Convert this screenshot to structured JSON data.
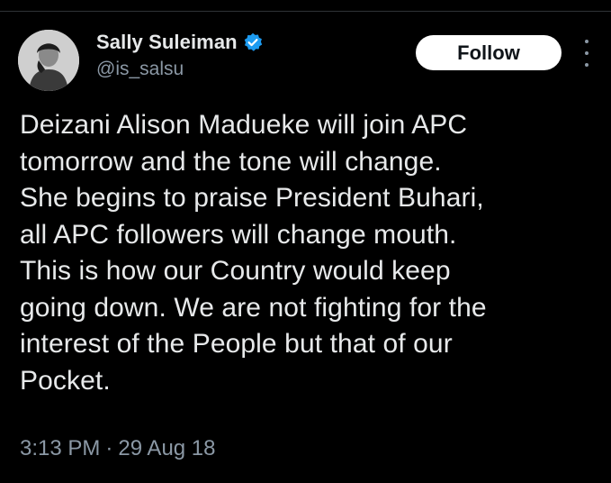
{
  "tweet": {
    "author": {
      "display_name": "Sally Suleiman",
      "handle": "@is_salsu",
      "verified": true,
      "avatar_icon": "profile-photo"
    },
    "follow_label": "Follow",
    "more_icon": "more-vertical-icon",
    "text": "Deizani Alison Madueke will join APC\ntomorrow and the tone will change.\nShe begins to praise President Buhari,\nall APC followers will change mouth.\nThis is how our Country would keep\ngoing down. We are not fighting for the\ninterest of the People but that of our\nPocket.",
    "time": "3:13 PM",
    "separator": "·",
    "date": "29 Aug 18"
  },
  "colors": {
    "background": "#000000",
    "text_primary": "#e7e9ea",
    "text_secondary": "#8b98a5",
    "verified_blue": "#1d9bf0",
    "follow_bg": "#ffffff",
    "follow_text": "#0f1419"
  }
}
